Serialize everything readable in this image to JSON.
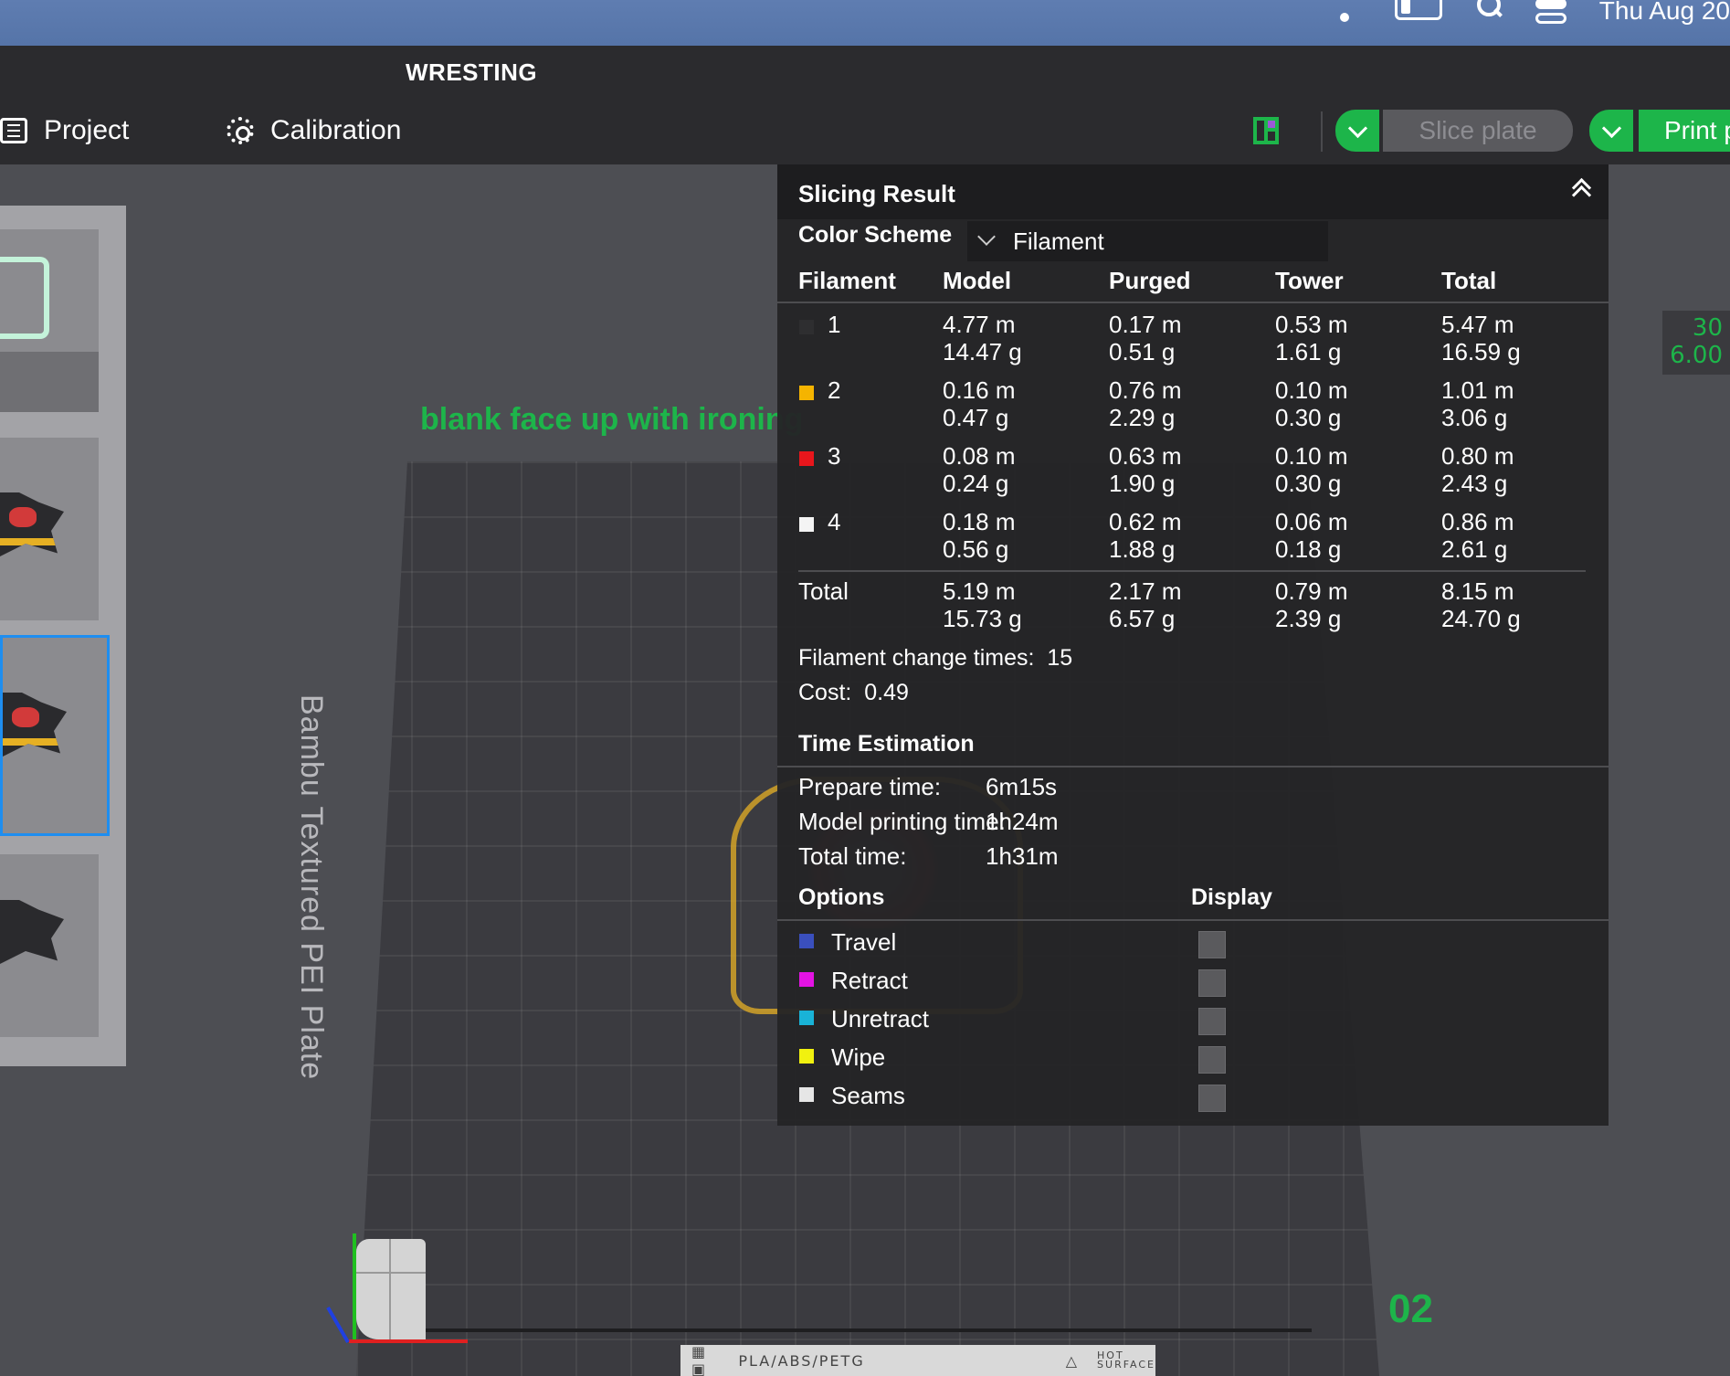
{
  "menubar": {
    "clock": "Thu Aug 20",
    "icons": [
      "wifi-icon",
      "battery-icon",
      "spotlight-search-icon",
      "control-center-icon"
    ]
  },
  "app": {
    "title": "WRESTING",
    "menu": [
      {
        "label": "Project",
        "icon": "list-icon"
      },
      {
        "label": "Calibration",
        "icon": "gear-icon"
      }
    ],
    "slice_button": "Slice plate",
    "print_button": "Print p",
    "accent_color": "#1db54a"
  },
  "viewport": {
    "plate_label": "Bambu Textured PEI Plate",
    "note": "blank face up with ironing",
    "plate_number": "02",
    "side_readout": [
      "30",
      "6.00"
    ],
    "bottom_strip": {
      "filament": "PLA/ABS/PETG",
      "warning_top": "HOT",
      "warning_bottom": "SURFACE"
    }
  },
  "slicing": {
    "title": "Slicing Result",
    "color_scheme_label": "Color Scheme",
    "color_scheme_value": "Filament",
    "columns": [
      "Filament",
      "Model",
      "Purged",
      "Tower",
      "Total"
    ],
    "rows": [
      {
        "id": "1",
        "color": "#2e2e30",
        "model": [
          "4.77 m",
          "14.47 g"
        ],
        "purged": [
          "0.17 m",
          "0.51 g"
        ],
        "tower": [
          "0.53 m",
          "1.61 g"
        ],
        "total": [
          "5.47 m",
          "16.59 g"
        ]
      },
      {
        "id": "2",
        "color": "#f5b400",
        "model": [
          "0.16 m",
          "0.47 g"
        ],
        "purged": [
          "0.76 m",
          "2.29 g"
        ],
        "tower": [
          "0.10 m",
          "0.30 g"
        ],
        "total": [
          "1.01 m",
          "3.06 g"
        ]
      },
      {
        "id": "3",
        "color": "#e8161c",
        "model": [
          "0.08 m",
          "0.24 g"
        ],
        "purged": [
          "0.63 m",
          "1.90 g"
        ],
        "tower": [
          "0.10 m",
          "0.30 g"
        ],
        "total": [
          "0.80 m",
          "2.43 g"
        ]
      },
      {
        "id": "4",
        "color": "#f4f4f4",
        "model": [
          "0.18 m",
          "0.56 g"
        ],
        "purged": [
          "0.62 m",
          "1.88 g"
        ],
        "tower": [
          "0.06 m",
          "0.18 g"
        ],
        "total": [
          "0.86 m",
          "2.61 g"
        ]
      }
    ],
    "total": {
      "label": "Total",
      "model": [
        "5.19 m",
        "15.73 g"
      ],
      "purged": [
        "2.17 m",
        "6.57 g"
      ],
      "tower": [
        "0.79 m",
        "2.39 g"
      ],
      "total": [
        "8.15 m",
        "24.70 g"
      ]
    },
    "filament_change_label": "Filament change times:",
    "filament_change_value": "15",
    "cost_label": "Cost:",
    "cost_value": "0.49",
    "time_title": "Time Estimation",
    "times": [
      {
        "label": "Prepare time:",
        "value": "6m15s"
      },
      {
        "label": "Model printing time:",
        "value": "1h24m"
      },
      {
        "label": "Total time:",
        "value": "1h31m"
      }
    ],
    "options_title": "Options",
    "display_title": "Display",
    "options": [
      {
        "label": "Travel",
        "color": "#3a4fbd"
      },
      {
        "label": "Retract",
        "color": "#e313e3"
      },
      {
        "label": "Unretract",
        "color": "#19b3d7"
      },
      {
        "label": "Wipe",
        "color": "#f1f10f"
      },
      {
        "label": "Seams",
        "color": "#e6e6e6"
      }
    ]
  }
}
